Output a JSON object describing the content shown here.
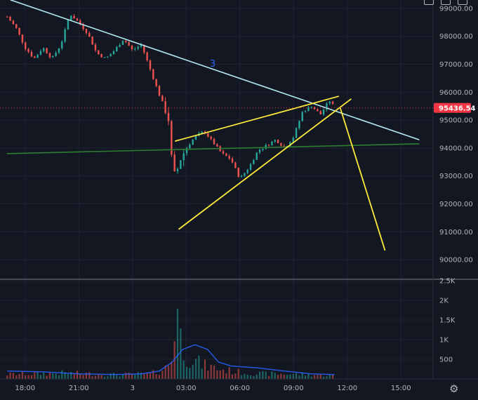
{
  "chart_data": {
    "type": "candlestick",
    "price_axis": {
      "labels": [
        "99000.00",
        "98000.00",
        "97000.00",
        "96000.00",
        "95000.00",
        "94000.00",
        "93000.00",
        "92000.00",
        "91000.00",
        "90000.00"
      ],
      "ylim": [
        89300,
        99300
      ]
    },
    "volume_axis": {
      "labels": [
        "2.5K",
        "2K",
        "1.5K",
        "1K",
        "500"
      ],
      "ylim": [
        0,
        2500
      ]
    },
    "time_axis": {
      "labels": [
        "18:00",
        "21:00",
        "3",
        "03:00",
        "06:00",
        "09:00",
        "12:00",
        "15:00"
      ],
      "start_hour": 17.5,
      "end_hour": 40
    },
    "current_price": "95436.54",
    "annotation_text": "3",
    "candle_anchors": [
      [
        17.0,
        98700
      ],
      [
        17.5,
        98300
      ],
      [
        18.0,
        97600
      ],
      [
        18.5,
        97200
      ],
      [
        19.0,
        97600
      ],
      [
        19.5,
        97200
      ],
      [
        20.0,
        97700
      ],
      [
        20.5,
        98800
      ],
      [
        21.0,
        98500
      ],
      [
        21.5,
        98100
      ],
      [
        22.0,
        97400
      ],
      [
        22.5,
        97200
      ],
      [
        23.0,
        97500
      ],
      [
        23.5,
        97900
      ],
      [
        24.0,
        97500
      ],
      [
        24.5,
        97700
      ],
      [
        25.0,
        96800
      ],
      [
        25.5,
        95900
      ],
      [
        26.0,
        95100
      ],
      [
        26.2,
        93500
      ],
      [
        26.4,
        92900
      ],
      [
        26.6,
        93500
      ],
      [
        27.0,
        94000
      ],
      [
        27.5,
        94400
      ],
      [
        28.0,
        94600
      ],
      [
        28.5,
        94200
      ],
      [
        29.0,
        93800
      ],
      [
        29.5,
        93600
      ],
      [
        30.0,
        92900
      ],
      [
        30.5,
        93300
      ],
      [
        31.0,
        93900
      ],
      [
        31.5,
        94100
      ],
      [
        32.0,
        94300
      ],
      [
        32.5,
        94000
      ],
      [
        33.0,
        94400
      ],
      [
        33.5,
        95300
      ],
      [
        34.0,
        95500
      ],
      [
        34.5,
        95200
      ],
      [
        35.0,
        95700
      ],
      [
        35.3,
        95450
      ]
    ],
    "volume_anchors": [
      [
        17.0,
        130
      ],
      [
        20.0,
        170
      ],
      [
        23.0,
        120
      ],
      [
        25.0,
        140
      ],
      [
        25.8,
        280
      ],
      [
        26.2,
        550
      ],
      [
        26.45,
        2300
      ],
      [
        26.7,
        1100
      ],
      [
        27.0,
        650
      ],
      [
        28.0,
        380
      ],
      [
        29.0,
        260
      ],
      [
        30.0,
        190
      ],
      [
        31.0,
        150
      ],
      [
        33.0,
        140
      ],
      [
        34.5,
        110
      ],
      [
        35.3,
        100
      ]
    ],
    "volume_ma": [
      [
        17.0,
        200
      ],
      [
        19.0,
        180
      ],
      [
        21.0,
        130
      ],
      [
        23.0,
        110
      ],
      [
        24.5,
        130
      ],
      [
        25.5,
        200
      ],
      [
        26.2,
        420
      ],
      [
        26.8,
        750
      ],
      [
        27.5,
        870
      ],
      [
        28.2,
        750
      ],
      [
        28.8,
        430
      ],
      [
        29.5,
        330
      ],
      [
        31.0,
        280
      ],
      [
        32.5,
        200
      ],
      [
        34.0,
        130
      ],
      [
        35.3,
        110
      ]
    ],
    "drawings": {
      "cyan_trendline": [
        [
          17.2,
          99300
        ],
        [
          40.0,
          94300
        ]
      ],
      "green_support": [
        [
          17.0,
          93800
        ],
        [
          40.0,
          94150
        ]
      ],
      "wedge_upper": [
        [
          26.4,
          94250
        ],
        [
          35.5,
          95850
        ]
      ],
      "wedge_lower": [
        [
          26.6,
          91100
        ],
        [
          36.2,
          95750
        ]
      ],
      "projection": [
        [
          35.6,
          95450
        ],
        [
          38.1,
          90350
        ]
      ]
    }
  }
}
